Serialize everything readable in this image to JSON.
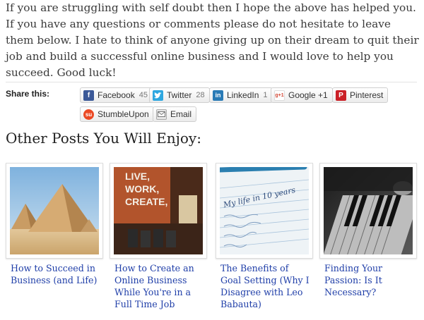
{
  "article": {
    "closing_paragraph": "If you are struggling with self doubt then I hope the above has helped you. If you have any questions or comments please do not hesitate to leave them below. I hate to think of anyone giving up on their dream to quit their job and build a successful online business and I would love to help you succeed. Good luck!"
  },
  "share": {
    "label": "Share this:",
    "buttons": [
      {
        "label": "Facebook",
        "count": "45",
        "icon": "facebook-icon",
        "color": "#3b5998"
      },
      {
        "label": "Twitter",
        "count": "28",
        "icon": "twitter-icon",
        "color": "#2ea7e0"
      },
      {
        "label": "LinkedIn",
        "count": "1",
        "icon": "linkedin-icon",
        "color": "#2a7bb6"
      },
      {
        "label": "Google +1",
        "count": "",
        "icon": "google-plus-icon",
        "color": "#d34836"
      },
      {
        "label": "Pinterest",
        "count": "",
        "icon": "pinterest-icon",
        "color": "#cb2027"
      },
      {
        "label": "StumbleUpon",
        "count": "",
        "icon": "stumbleupon-icon",
        "color": "#eb4924"
      },
      {
        "label": "Email",
        "count": "",
        "icon": "email-icon",
        "color": "#888888"
      }
    ]
  },
  "related": {
    "heading": "Other Posts You Will Enjoy:",
    "posts": [
      {
        "title": "How to Succeed in Business (and Life)",
        "image": "pyramids-photo"
      },
      {
        "title": "How to Create an Online Business While You're in a Full Time Job",
        "image": "live-work-create-photo",
        "image_text": [
          "LIVE,",
          "WORK,",
          "CREATE,"
        ]
      },
      {
        "title": "The Benefits of Goal Setting (Why I Disagree with Leo Babauta)",
        "image": "notebook-photo",
        "image_text": "My life in 10 years"
      },
      {
        "title": "Finding Your Passion: Is It Necessary?",
        "image": "piano-photo"
      }
    ]
  },
  "colors": {
    "link": "#1f3ea8",
    "text": "#3a3a3a"
  }
}
